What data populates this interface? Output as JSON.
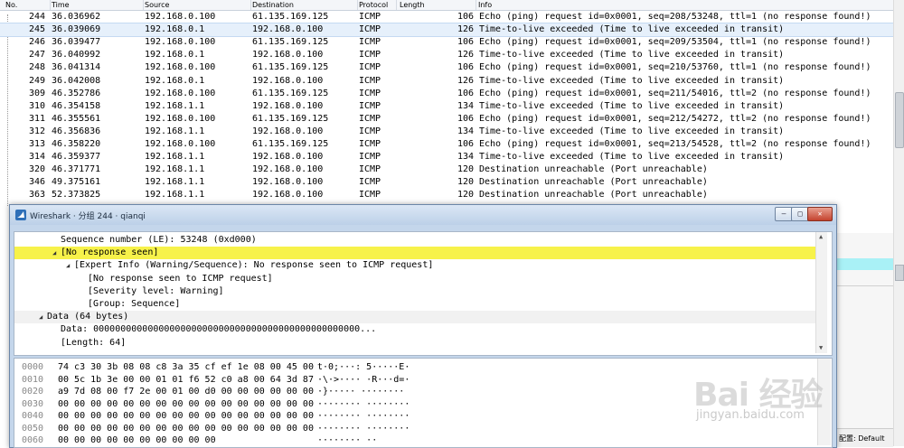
{
  "packet_list": {
    "columns": {
      "no": "No.",
      "time": "Time",
      "source": "Source",
      "destination": "Destination",
      "protocol": "Protocol",
      "length": "Length",
      "info": "Info"
    },
    "rows": [
      {
        "no": "244",
        "time": "36.036962",
        "src": "192.168.0.100",
        "dst": "61.135.169.125",
        "proto": "ICMP",
        "len": "106",
        "info": "Echo (ping) request  id=0x0001, seq=208/53248, ttl=1 (no response found!)"
      },
      {
        "no": "245",
        "time": "36.039069",
        "src": "192.168.0.1",
        "dst": "192.168.0.100",
        "proto": "ICMP",
        "len": "126",
        "info": "Time-to-live exceeded (Time to live exceeded in transit)"
      },
      {
        "no": "246",
        "time": "36.039477",
        "src": "192.168.0.100",
        "dst": "61.135.169.125",
        "proto": "ICMP",
        "len": "106",
        "info": "Echo (ping) request  id=0x0001, seq=209/53504, ttl=1 (no response found!)"
      },
      {
        "no": "247",
        "time": "36.040992",
        "src": "192.168.0.1",
        "dst": "192.168.0.100",
        "proto": "ICMP",
        "len": "126",
        "info": "Time-to-live exceeded (Time to live exceeded in transit)"
      },
      {
        "no": "248",
        "time": "36.041314",
        "src": "192.168.0.100",
        "dst": "61.135.169.125",
        "proto": "ICMP",
        "len": "106",
        "info": "Echo (ping) request  id=0x0001, seq=210/53760, ttl=1 (no response found!)"
      },
      {
        "no": "249",
        "time": "36.042008",
        "src": "192.168.0.1",
        "dst": "192.168.0.100",
        "proto": "ICMP",
        "len": "126",
        "info": "Time-to-live exceeded (Time to live exceeded in transit)"
      },
      {
        "no": "309",
        "time": "46.352786",
        "src": "192.168.0.100",
        "dst": "61.135.169.125",
        "proto": "ICMP",
        "len": "106",
        "info": "Echo (ping) request  id=0x0001, seq=211/54016, ttl=2 (no response found!)"
      },
      {
        "no": "310",
        "time": "46.354158",
        "src": "192.168.1.1",
        "dst": "192.168.0.100",
        "proto": "ICMP",
        "len": "134",
        "info": "Time-to-live exceeded (Time to live exceeded in transit)"
      },
      {
        "no": "311",
        "time": "46.355561",
        "src": "192.168.0.100",
        "dst": "61.135.169.125",
        "proto": "ICMP",
        "len": "106",
        "info": "Echo (ping) request  id=0x0001, seq=212/54272, ttl=2 (no response found!)"
      },
      {
        "no": "312",
        "time": "46.356836",
        "src": "192.168.1.1",
        "dst": "192.168.0.100",
        "proto": "ICMP",
        "len": "134",
        "info": "Time-to-live exceeded (Time to live exceeded in transit)"
      },
      {
        "no": "313",
        "time": "46.358220",
        "src": "192.168.0.100",
        "dst": "61.135.169.125",
        "proto": "ICMP",
        "len": "106",
        "info": "Echo (ping) request  id=0x0001, seq=213/54528, ttl=2 (no response found!)"
      },
      {
        "no": "314",
        "time": "46.359377",
        "src": "192.168.1.1",
        "dst": "192.168.0.100",
        "proto": "ICMP",
        "len": "134",
        "info": "Time-to-live exceeded (Time to live exceeded in transit)"
      },
      {
        "no": "320",
        "time": "46.371771",
        "src": "192.168.1.1",
        "dst": "192.168.0.100",
        "proto": "ICMP",
        "len": "120",
        "info": "Destination unreachable (Port unreachable)"
      },
      {
        "no": "346",
        "time": "49.375161",
        "src": "192.168.1.1",
        "dst": "192.168.0.100",
        "proto": "ICMP",
        "len": "120",
        "info": "Destination unreachable (Port unreachable)"
      },
      {
        "no": "363",
        "time": "52.373825",
        "src": "192.168.1.1",
        "dst": "192.168.0.100",
        "proto": "ICMP",
        "len": "120",
        "info": "Destination unreachable (Port unreachable)"
      }
    ],
    "selected_no": "245"
  },
  "dialog": {
    "title": "Wireshark · 分组 244 · qianqi",
    "icon": "wireshark-fin-icon",
    "btn_min": "—",
    "btn_max": "□",
    "btn_close": "✕"
  },
  "details": [
    {
      "text": "Sequence number (LE): 53248 (0xd000)",
      "indent": 1,
      "twisty": "",
      "style": ""
    },
    {
      "text": "[No response seen]",
      "indent": 1,
      "twisty": "◢",
      "style": "hl"
    },
    {
      "text": "[Expert Info (Warning/Sequence): No response seen to ICMP request]",
      "indent": 2,
      "twisty": "◢",
      "style": ""
    },
    {
      "text": "[No response seen to ICMP request]",
      "indent": 3,
      "twisty": "",
      "style": ""
    },
    {
      "text": "[Severity level: Warning]",
      "indent": 3,
      "twisty": "",
      "style": ""
    },
    {
      "text": "[Group: Sequence]",
      "indent": 3,
      "twisty": "",
      "style": ""
    },
    {
      "text": "Data (64 bytes)",
      "indent": 0,
      "twisty": "◢",
      "style": "grp"
    },
    {
      "text": "Data: 0000000000000000000000000000000000000000000000000...",
      "indent": 1,
      "twisty": "",
      "style": ""
    },
    {
      "text": "[Length: 64]",
      "indent": 1,
      "twisty": "",
      "style": ""
    }
  ],
  "bytes": [
    {
      "off": "0000",
      "hex": "74 c3 30 3b 08 08 c8 3a  35 cf ef 1e 08 00 45 00",
      "ascii": "t·0;···:  5·····E·"
    },
    {
      "off": "0010",
      "hex": "00 5c 1b 3e 00 00 01 01  f6 52 c0 a8 00 64 3d 87",
      "ascii": "·\\·>····  ·R···d=·"
    },
    {
      "off": "0020",
      "hex": "a9 7d 08 00 f7 2e 00 01  00 d0 00 00 00 00 00 00",
      "ascii": "·}·····  ········"
    },
    {
      "off": "0030",
      "hex": "00 00 00 00 00 00 00 00  00 00 00 00 00 00 00 00",
      "ascii": "········  ········"
    },
    {
      "off": "0040",
      "hex": "00 00 00 00 00 00 00 00  00 00 00 00 00 00 00 00",
      "ascii": "········  ········"
    },
    {
      "off": "0050",
      "hex": "00 00 00 00 00 00 00 00  00 00 00 00 00 00 00 00",
      "ascii": "········  ········"
    },
    {
      "off": "0060",
      "hex": "00 00 00 00 00 00 00 00  00 00",
      "ascii": "········  ··"
    }
  ],
  "statusbar": {
    "profile": "配置: Default"
  },
  "watermark": {
    "text": "Bai 经验",
    "url": "jingyan.baidu.com"
  },
  "colors": {
    "highlight": "#f7f24a",
    "selected": "#e6f0fb",
    "cyan": "#a9f1f6"
  }
}
